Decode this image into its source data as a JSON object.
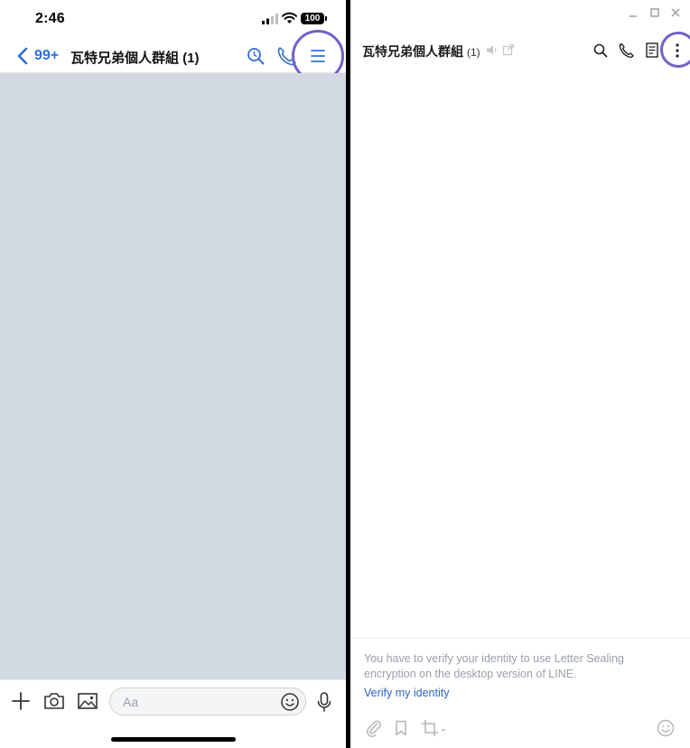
{
  "mobile": {
    "status_bar": {
      "time": "2:46",
      "battery": "100"
    },
    "header": {
      "back_count": "99+",
      "title": "瓦特兄弟個人群組 (1)"
    },
    "input_bar": {
      "placeholder": "Aa"
    },
    "icons": [
      "chevron-left-icon",
      "search-icon",
      "phone-icon",
      "menu-icon",
      "plus-icon",
      "camera-icon",
      "image-icon",
      "emoji-icon",
      "microphone-icon"
    ]
  },
  "desktop": {
    "header": {
      "title": "瓦特兄弟個人群組",
      "count": "(1)"
    },
    "notice": {
      "text": "You have to verify your identity to use Letter Sealing encryption on the desktop version of LINE.",
      "link": "Verify my identity"
    },
    "icons": [
      "minimize-icon",
      "maximize-icon",
      "close-icon",
      "speaker-icon",
      "popout-icon",
      "search-icon",
      "phone-icon",
      "note-icon",
      "more-vertical-icon",
      "paperclip-icon",
      "bookmark-icon",
      "crop-icon",
      "emoji-icon"
    ]
  },
  "colors": {
    "accent_blue": "#2f6fd8",
    "highlight_circle": "#6e63c9",
    "mobile_chat_bg": "#d3d9e3",
    "link_blue": "#2e62c9"
  }
}
